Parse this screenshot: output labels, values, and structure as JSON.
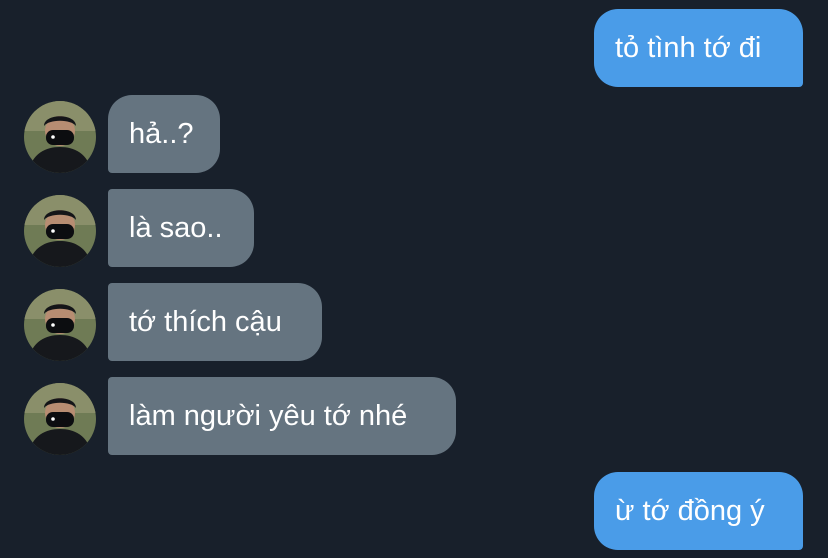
{
  "messages": [
    {
      "sender": "me",
      "text": "tỏ tình tớ đi"
    },
    {
      "sender": "them",
      "text": "hả..?"
    },
    {
      "sender": "them",
      "text": "là sao.."
    },
    {
      "sender": "them",
      "text": "tớ thích cậu"
    },
    {
      "sender": "them",
      "text": "làm người yêu tớ nhé"
    },
    {
      "sender": "me",
      "text": "ừ tớ đồng ý"
    }
  ],
  "colors": {
    "background": "#18202b",
    "sent_bubble": "#4a9ce8",
    "received_bubble": "#657480",
    "text": "#ffffff"
  },
  "avatar_icon": "masked-person-avatar-icon"
}
